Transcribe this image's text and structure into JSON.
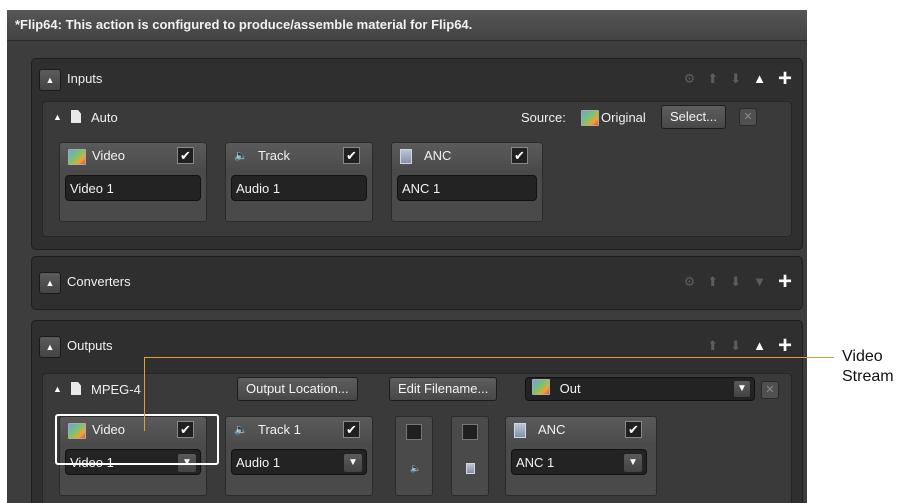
{
  "window": {
    "title": "*Flip64: This action is configured to produce/assemble material for Flip64."
  },
  "inputs": {
    "title": "Inputs",
    "source_group": {
      "name": "Auto",
      "source_label": "Source:",
      "source_value": "Original",
      "select_label": "Select...",
      "remove_label": "✕"
    },
    "streams": [
      {
        "label": "Video",
        "icon": "film-icon",
        "checked": true,
        "value": "Video 1"
      },
      {
        "label": "Track",
        "icon": "speaker-icon",
        "checked": true,
        "value": "Audio 1"
      },
      {
        "label": "ANC",
        "icon": "anc-icon",
        "checked": true,
        "value": "ANC 1"
      }
    ]
  },
  "converters": {
    "title": "Converters"
  },
  "outputs": {
    "title": "Outputs",
    "format_group": {
      "name": "MPEG-4",
      "output_location_label": "Output Location...",
      "edit_filename_label": "Edit Filename...",
      "destination_value": "Out",
      "remove_label": "✕"
    },
    "streams": [
      {
        "label": "Video",
        "icon": "film-icon",
        "checked": true,
        "value": "Video 1"
      },
      {
        "label": "Track 1",
        "icon": "speaker-icon",
        "checked": true,
        "value": "Audio 1"
      },
      {
        "label": "",
        "icon": "speaker-icon",
        "checked": false
      },
      {
        "label": "",
        "icon": "anc-icon",
        "checked": false
      },
      {
        "label": "ANC",
        "icon": "anc-icon",
        "checked": true,
        "value": "ANC 1"
      }
    ]
  },
  "glyphs": {
    "collapse": "▲",
    "check": "✔",
    "dropdown": "▼",
    "plus": "+",
    "gear": "⚙",
    "up": "⬆",
    "down": "⬇",
    "up_triangle": "▲",
    "down_triangle": "▼",
    "speaker": "🔈"
  },
  "callout": {
    "line1": "Video",
    "line2": "Stream"
  },
  "colors": {
    "panel_bg": "#2f2f2f",
    "window_bg": "#3d3d3d",
    "callout_line": "#e89a3a",
    "audio_icon": "#f1b233"
  }
}
